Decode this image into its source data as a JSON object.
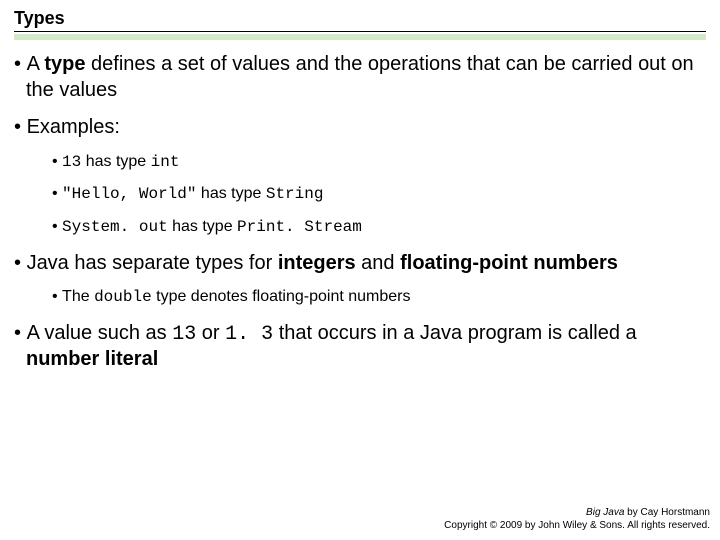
{
  "title": "Types",
  "bullets": {
    "b1_pre": "A ",
    "b1_strong": "type",
    "b1_post": " defines a set of values and the operations that can be carried out on the values",
    "b2": "Examples:",
    "b2a_code1": "13",
    "b2a_mid": " has type ",
    "b2a_code2": "int",
    "b2b_code1": "\"Hello, World\"",
    "b2b_mid": " has type ",
    "b2b_code2": "String",
    "b2c_code1": "System. out",
    "b2c_mid": " has type ",
    "b2c_code2": "Print. Stream",
    "b3_pre": "Java has separate types for ",
    "b3_strong1": "integers",
    "b3_mid": " and ",
    "b3_strong2": "floating-point numbers",
    "b3a_pre": "The ",
    "b3a_code": "double",
    "b3a_post": " type denotes floating-point numbers",
    "b4_pre": "A value such as ",
    "b4_code1": "13",
    "b4_mid": " or ",
    "b4_code2": "1. 3",
    "b4_post1": " that occurs in a Java program is called a ",
    "b4_strong": "number literal"
  },
  "footer": {
    "line1_ital": "Big Java",
    "line1_rest": " by Cay Horstmann",
    "line2": "Copyright © 2009 by John Wiley & Sons.  All rights reserved."
  }
}
